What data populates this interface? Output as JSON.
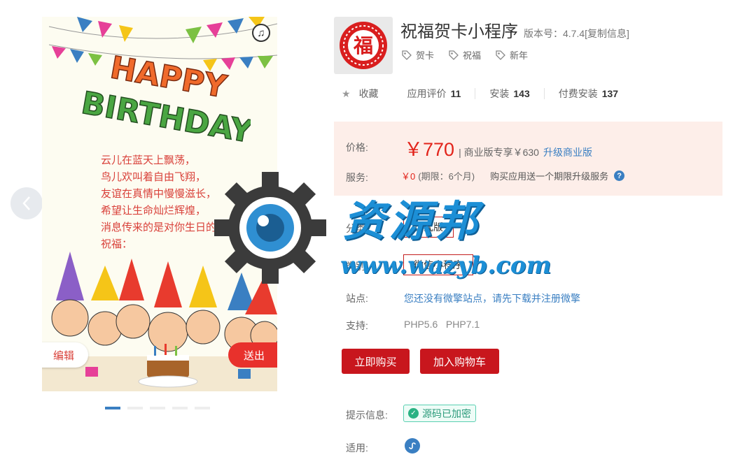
{
  "preview": {
    "headline_line1": "HAPPY",
    "headline_line2": "BIRTHDAY",
    "poem": [
      "云儿在蓝天上飘荡，",
      "鸟儿欢叫着自由飞翔，",
      "友谊在真情中慢慢滋长，",
      "希望让生命灿烂辉煌，",
      "消息传来的是对你生日的",
      "祝福："
    ],
    "edit_label": "编辑",
    "send_label": "送出",
    "music_icon": "music-note-icon",
    "dots": 5,
    "active_dot": 0
  },
  "app": {
    "title": "祝福贺卡小程序",
    "version": "版本号：4.7.4[复制信息]",
    "icon_char": "福",
    "tags": [
      "贺卡",
      "祝福",
      "新年"
    ]
  },
  "stats": {
    "favorite": "收藏",
    "rating_label": "应用评价",
    "rating_value": "11",
    "install_label": "安装",
    "install_value": "143",
    "paid_label": "付费安装",
    "paid_value": "137"
  },
  "pricing": {
    "price_label": "价格:",
    "price": "￥770",
    "pro_note": "| 商业版专享￥630",
    "upgrade_link": "升级商业版",
    "service_label": "服务:",
    "service_value": "￥0",
    "service_period": "(期限：6个月)",
    "service_note": "购买应用送一个期限升级服务",
    "help_icon": "?"
  },
  "details": {
    "category_label": "分类:",
    "category_value": "正式版",
    "type_label": "类别:",
    "type_value": "微信小程序",
    "site_label": "站点:",
    "site_text": "您还没有微擎站点，请先下载并注册微擎",
    "support_label": "支持:",
    "support_value": "PHP5.6   PHP7.1",
    "buy_label": "立即购买",
    "cart_label": "加入购物车",
    "tips_label": "提示信息:",
    "encrypted_label": "源码已加密",
    "fit_label": "适用:"
  },
  "watermark": {
    "text": "资源邦",
    "url": "www.wazyb.com"
  },
  "colors": {
    "accent_red": "#c8161d",
    "price_red": "#e2231a",
    "link_blue": "#3a7fc2",
    "price_bg": "#fdeee9"
  }
}
